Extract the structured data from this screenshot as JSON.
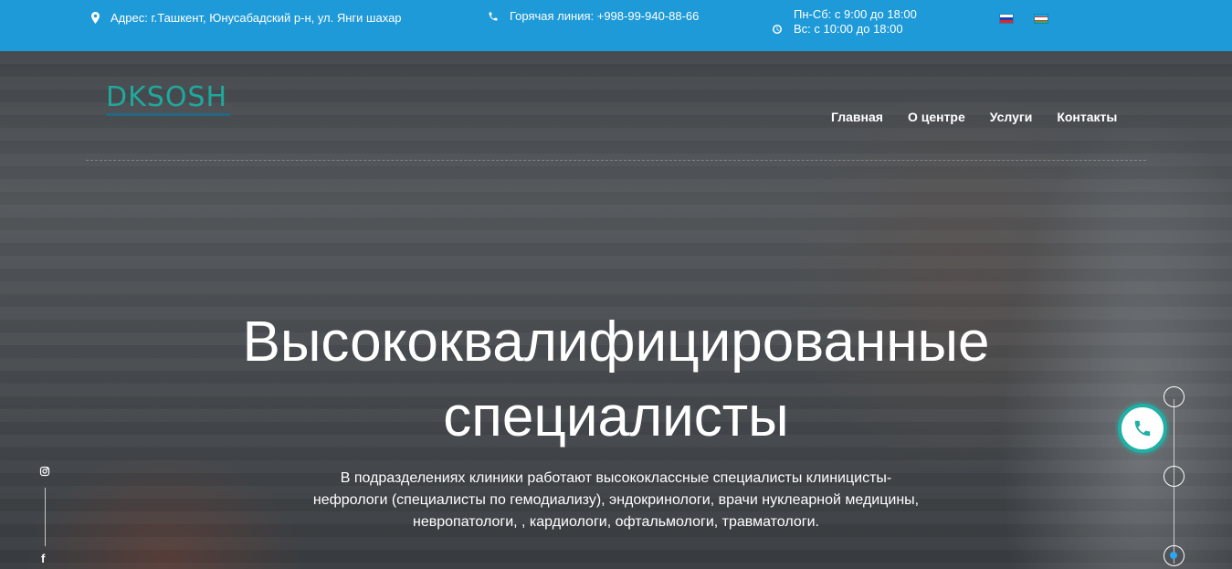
{
  "topbar": {
    "address": "Адрес: г.Ташкент, Юнусабадский р-н, ул. Янги шахар",
    "hotline": "Горячая линия: +998-99-940-88-66",
    "hours_weekdays": "Пн-Сб: с 9:00 до 18:00",
    "hours_sunday": "Вс: с 10:00 до 18:00",
    "icons": [
      "map-pin-icon",
      "phone-icon",
      "clock-icon"
    ],
    "languages": [
      "ru",
      "uz"
    ]
  },
  "logo": {
    "text": "DKSOSH"
  },
  "nav": {
    "items": [
      {
        "label": "Главная"
      },
      {
        "label": "О центре"
      },
      {
        "label": "Услуги"
      },
      {
        "label": "Контакты"
      }
    ]
  },
  "hero": {
    "title_line1": "Высококвалифицированные",
    "title_line2": "специалисты",
    "description": "В подразделениях клиники работают высококлассные специалисты клиницисты-нефрологи (специалисты по гемодиализу), эндокринологи, врачи нуклеарной медицины, невропатологи, , кардиологи, офтальмологи, травматологи.",
    "slides": 3,
    "active_slide": 3
  },
  "social": {
    "icons": [
      "instagram-icon",
      "facebook-icon"
    ],
    "facebook_glyph": "f"
  },
  "colors": {
    "topbar": "#1e9ad8",
    "accent": "#1fb0a5",
    "logo": "#1fa89c",
    "active_dot": "#2fa3ee"
  }
}
